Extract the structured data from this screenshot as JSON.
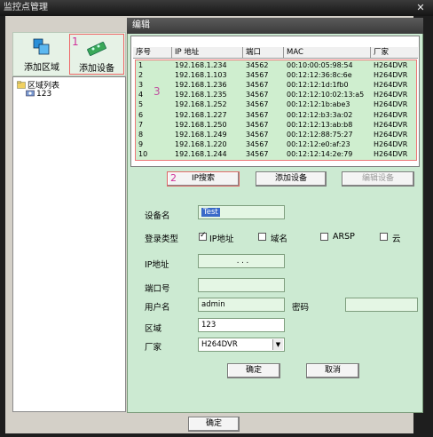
{
  "window": {
    "title": "监控点管理",
    "close_glyph": "✕"
  },
  "toolbar": {
    "add_region": "添加区域",
    "add_device": "添加设备",
    "marker_1": "1"
  },
  "tree": {
    "root": "区域列表",
    "child": "123"
  },
  "panel": {
    "title": "编辑",
    "marker_3": "3",
    "marker_2": "2"
  },
  "table": {
    "headers": [
      "序号",
      "IP 地址",
      "端口",
      "MAC",
      "厂家"
    ],
    "rows": [
      [
        "1",
        "192.168.1.234",
        "34562",
        "00:10:00:05:98:54",
        "H264DVR"
      ],
      [
        "2",
        "192.168.1.103",
        "34567",
        "00:12:12:36:8c:6e",
        "H264DVR"
      ],
      [
        "3",
        "192.168.1.236",
        "34567",
        "00:12:12:1d:1fb0",
        "H264DVR"
      ],
      [
        "4",
        "192.168.1.235",
        "34567",
        "00:12:12:10:02:13:a5",
        "H264DVR"
      ],
      [
        "5",
        "192.168.1.252",
        "34567",
        "00:12:12:1b:abe3",
        "H264DVR"
      ],
      [
        "6",
        "192.168.1.227",
        "34567",
        "00:12:12:b3:3a:02",
        "H264DVR"
      ],
      [
        "7",
        "192.168.1.250",
        "34567",
        "00:12:12:13:ab:b8",
        "H264DVR"
      ],
      [
        "8",
        "192.168.1.249",
        "34567",
        "00:12:12:88:75:27",
        "H264DVR"
      ],
      [
        "9",
        "192.168.1.220",
        "34567",
        "00:12:12:e0:af:23",
        "H264DVR"
      ],
      [
        "10",
        "192.168.1.244",
        "34567",
        "00:12:12:14:2e:79",
        "H264DVR"
      ]
    ]
  },
  "buttons": {
    "ip_search": "IP搜索",
    "add_device": "添加设备",
    "edit_device": "编辑设备",
    "confirm": "确定",
    "cancel": "取消",
    "bottom_confirm": "确定"
  },
  "form": {
    "device_name_label": "设备名",
    "device_name_value": "Test",
    "login_type_label": "登录类型",
    "opt_ip": "IP地址",
    "opt_domain": "域名",
    "opt_arsp": "ARSP",
    "opt_cloud": "云",
    "ip_label": "IP地址",
    "ip_value": ".      .      .",
    "port_label": "端口号",
    "port_value": "",
    "user_label": "用户名",
    "user_value": "admin",
    "pwd_label": "密码",
    "pwd_value": "",
    "region_label": "区域",
    "region_value": "123",
    "vendor_label": "厂家",
    "vendor_value": "H264DVR"
  },
  "colors": {
    "panel_bg": "#ccead2",
    "highlight_border": "#e77",
    "marker": "#d0309a"
  },
  "icons": [
    "add-region-icon",
    "add-device-icon",
    "folder-icon",
    "camera-group-icon",
    "close-icon",
    "chevron-down-icon"
  ]
}
